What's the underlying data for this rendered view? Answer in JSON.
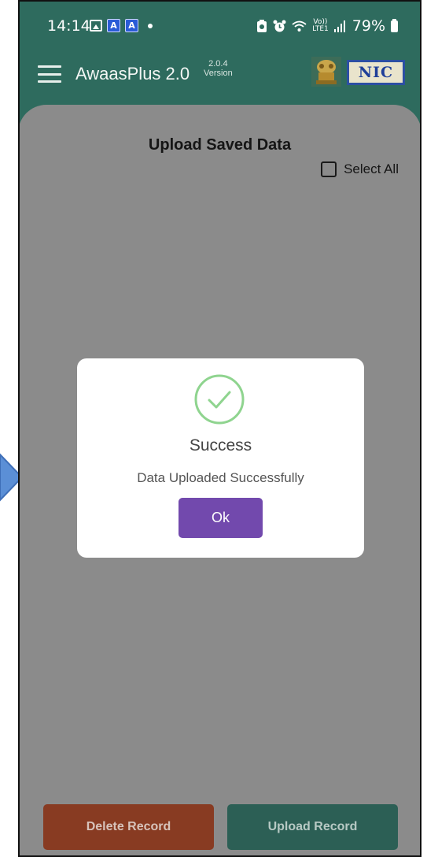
{
  "status_bar": {
    "time": "14:14",
    "a_badge": "A",
    "volte": "Vo))",
    "lte": "LTE1",
    "battery": "79%"
  },
  "app_bar": {
    "title": "AwaasPlus 2.0",
    "version_number": "2.0.4",
    "version_label": "Version",
    "nic_logo": "NIC"
  },
  "page": {
    "title": "Upload Saved Data",
    "select_all_label": "Select All",
    "select_all_checked": false
  },
  "dialog": {
    "icon": "check-circle-icon",
    "title": "Success",
    "message": "Data Uploaded Successfully",
    "ok_label": "Ok"
  },
  "buttons": {
    "delete_label": "Delete Record",
    "upload_label": "Upload Record"
  },
  "colors": {
    "header": "#2e6b5e",
    "overlay": "#8b8b8b",
    "ok_button": "#7249ad",
    "delete_button": "#883b22",
    "upload_button": "#2c5f55",
    "success_icon": "#8fd48f"
  }
}
